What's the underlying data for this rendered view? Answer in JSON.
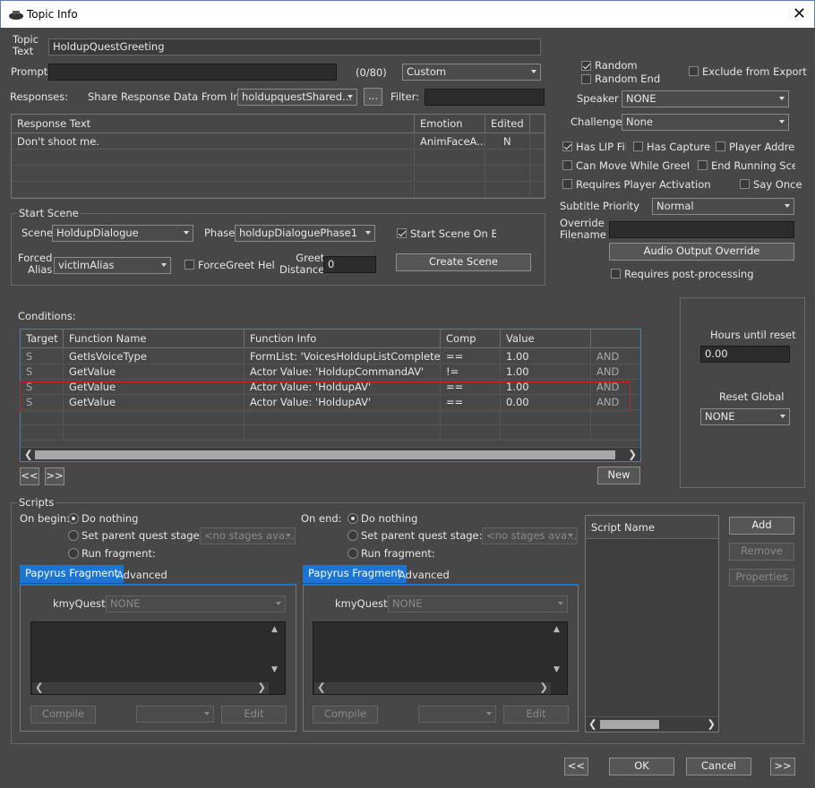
{
  "window": {
    "title": "Topic Info",
    "close": "✕"
  },
  "topic": {
    "label": "Topic Text",
    "label1": "Topic",
    "label2": "Text",
    "value": "HoldupQuestGreeting"
  },
  "prompt": {
    "label": "Prompt:",
    "value": "",
    "counter": "(0/80)",
    "type": "Custom"
  },
  "responses": {
    "label": "Responses:",
    "share_label": "Share Response Data From Info:",
    "share_value": "holdupquestShared...",
    "browse": "...",
    "filter_label": "Filter:",
    "filter_value": "",
    "columns": [
      "Response Text",
      "Emotion",
      "Edited"
    ],
    "rows": [
      {
        "text": "Don't shoot me.",
        "emotion": "AnimFaceA...",
        "edited": "N"
      }
    ]
  },
  "flags": {
    "random": "Random",
    "random_end": "Random End",
    "exclude": "Exclude from Export",
    "speaker_label": "Speaker",
    "speaker": "NONE",
    "challenge_label": "Challenge",
    "challenge": "None",
    "has_lip": "Has LIP File",
    "has_capture": "Has Capture",
    "player_address": "Player Address",
    "can_move": "Can Move While Greeting",
    "end_running": "End Running Scene",
    "requires_activation": "Requires Player Activation",
    "say_once": "Say Once",
    "subtitle_label": "Subtitle Priority",
    "subtitle": "Normal",
    "override_label1": "Override",
    "override_label2": "Filename",
    "override_value": "",
    "audio_override": "Audio Output Override",
    "post_processing": "Requires post-processing"
  },
  "start_scene": {
    "title": "Start Scene",
    "scene_label": "Scene",
    "scene": "HoldupDialogue",
    "phase_label": "Phase",
    "phase": "holdupDialoguePhase1",
    "start_on_end": "Start Scene On End",
    "forced_label1": "Forced",
    "forced_label2": "Alias",
    "forced_alias": "victimAlias",
    "forcegreet": "ForceGreet Hello",
    "greet_label1": "Greet",
    "greet_label2": "Distance",
    "greet_value": "0",
    "create": "Create Scene"
  },
  "conditions": {
    "label": "Conditions:",
    "columns": [
      "Target",
      "Function Name",
      "Function Info",
      "Comp",
      "Value",
      ""
    ],
    "rows": [
      {
        "target": "S",
        "func": "GetIsVoiceType",
        "info": "FormList: 'VoicesHoldupListComplete'",
        "comp": "==",
        "value": "1.00",
        "op": "AND"
      },
      {
        "target": "S",
        "func": "GetValue",
        "info": "Actor Value: 'HoldupCommandAV'",
        "comp": "!=",
        "value": "1.00",
        "op": "AND"
      },
      {
        "target": "S",
        "func": "GetValue",
        "info": "Actor Value: 'HoldupAV'",
        "comp": "==",
        "value": "1.00",
        "op": "AND"
      },
      {
        "target": "S",
        "func": "GetValue",
        "info": "Actor Value: 'HoldupAV'",
        "comp": "==",
        "value": "0.00",
        "op": "AND"
      }
    ],
    "prev": "<<",
    "next": ">>",
    "new": "New"
  },
  "reset": {
    "hours_label": "Hours until reset",
    "hours": "0.00",
    "global_label": "Reset Global",
    "global": "NONE"
  },
  "scripts": {
    "title": "Scripts",
    "on_begin": "On begin:",
    "on_end": "On end:",
    "do_nothing": "Do nothing",
    "set_stage": "Set parent quest stage:",
    "no_stages": "<no stages ava...",
    "run_fragment": "Run fragment:",
    "tab_fragment": "Papyrus Fragment",
    "tab_advanced": "Advanced",
    "quest_label": "kmyQuest",
    "quest_value": "NONE",
    "compile": "Compile",
    "edit": "Edit",
    "script_name": "Script Name",
    "add": "Add",
    "remove": "Remove",
    "properties": "Properties"
  },
  "footer": {
    "prev": "<<",
    "ok": "OK",
    "cancel": "Cancel",
    "next": ">>"
  }
}
